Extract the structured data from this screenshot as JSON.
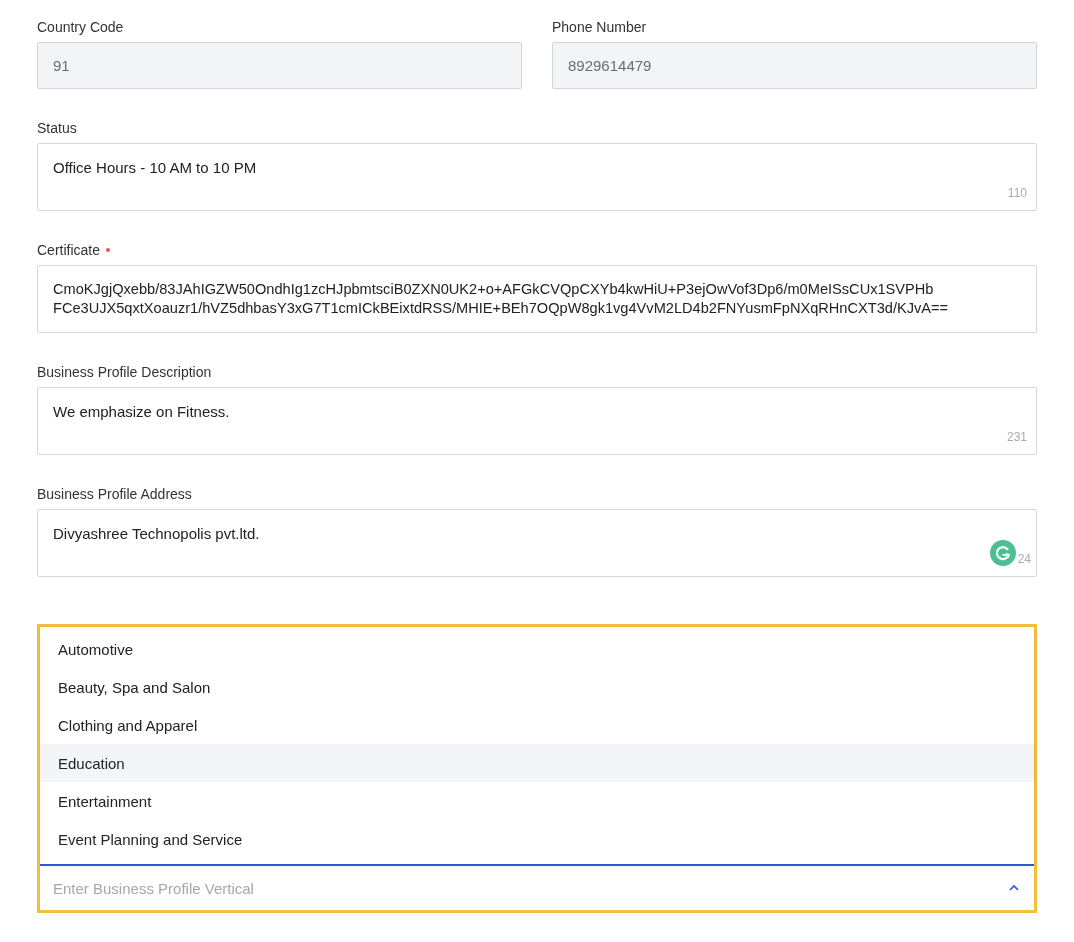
{
  "fields": [
    {
      "kind": "input",
      "label": "Country Code",
      "value": "91",
      "disabled": true
    },
    {
      "kind": "input",
      "label": "Phone Number",
      "value": "8929614479",
      "disabled": true
    },
    {
      "kind": "textarea",
      "label": "Status",
      "value": "Office Hours - 10 AM to 10 PM",
      "counter": "110"
    },
    {
      "kind": "textarea",
      "label": "Certificate",
      "required": true,
      "lines": [
        "CmoKJgjQxebb/83JAhIGZW50OndhIg1zcHJpbmtsciB0ZXN0UK2+o+AFGkCVQpCXYb4kwHiU+P3ejOwVof3Dp6/m0MeISsCUx1SVPHb",
        "FCe3UJX5qxtXoauzr1/hVZ5dhbasY3xG7T1cmICkBEixtdRSS/MHIE+BEh7OQpW8gk1vg4VvM2LD4b2FNYusmFpNXqRHnCXT3d/KJvA=="
      ]
    },
    {
      "kind": "textarea",
      "label": "Business Profile Description",
      "value": "We emphasize on Fitness.",
      "counter": "231"
    },
    {
      "kind": "textarea",
      "label": "Business Profile Address",
      "value": "Divyashree Technopolis pvt.ltd.",
      "counter": "24",
      "assistant_badge": true
    }
  ],
  "vertical_dropdown": {
    "expanded": true,
    "placeholder": "Enter Business Profile Vertical",
    "options": [
      {
        "label": "Automotive",
        "selected": false
      },
      {
        "label": "Beauty, Spa and Salon",
        "selected": false
      },
      {
        "label": "Clothing and Apparel",
        "selected": false
      },
      {
        "label": "Education",
        "selected": true
      },
      {
        "label": "Entertainment",
        "selected": false
      },
      {
        "label": "Event Planning and Service",
        "selected": false
      }
    ]
  }
}
